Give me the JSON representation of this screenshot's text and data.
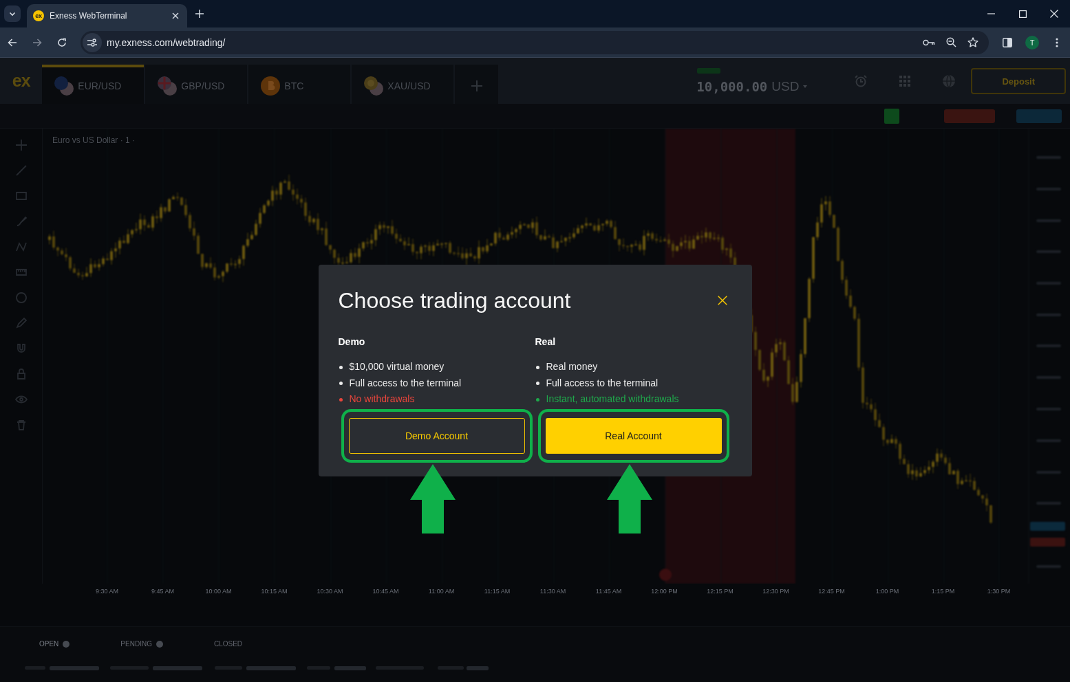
{
  "browser": {
    "tab": {
      "favicon": "ex",
      "title": "Exness WebTerminal"
    },
    "address_bar": {
      "url": "my.exness.com/webtrading/"
    },
    "profile_initial": "T"
  },
  "terminal": {
    "logo": "ex",
    "instrument_tabs": [
      {
        "label": "EUR/USD",
        "kind": "euro",
        "selected": true
      },
      {
        "label": "GBP/USD",
        "kind": "pound",
        "selected": false
      },
      {
        "label": "BTC",
        "kind": "bitcoin",
        "selected": false
      },
      {
        "label": "XAU/USD",
        "kind": "gold",
        "selected": false
      }
    ],
    "balance": {
      "amount": "10,000.00",
      "currency": "USD"
    },
    "deposit_button": "Deposit",
    "chart": {
      "title": "Euro vs US Dollar · 1 ·",
      "time_labels": [
        "9:30 AM",
        "9:45 AM",
        "10:00 AM",
        "10:15 AM",
        "10:30 AM",
        "10:45 AM",
        "11:00 AM",
        "11:15 AM",
        "11:30 AM",
        "11:45 AM",
        "12:00 PM",
        "12:15 PM",
        "12:30 PM",
        "12:45 PM",
        "1:00 PM",
        "1:15 PM",
        "1:30 PM"
      ]
    },
    "bottom_tabs": [
      {
        "label": "OPEN",
        "selected": true,
        "count_badge": true
      },
      {
        "label": "PENDING",
        "selected": false,
        "count_badge": true
      },
      {
        "label": "CLOSED",
        "selected": false,
        "count_badge": false
      }
    ]
  },
  "dialog": {
    "title": "Choose trading account",
    "options": [
      {
        "heading": "Demo",
        "features": [
          {
            "text": "$10,000 virtual money",
            "kind": "plain"
          },
          {
            "text": "Full access to the terminal",
            "kind": "plain"
          },
          {
            "text": "No withdrawals",
            "kind": "negative"
          }
        ],
        "button": {
          "label": "Demo Account",
          "kind": "outline",
          "highlighted": true
        }
      },
      {
        "heading": "Real",
        "features": [
          {
            "text": "Real money",
            "kind": "plain"
          },
          {
            "text": "Full access to the terminal",
            "kind": "plain"
          },
          {
            "text": "Instant, automated withdrawals",
            "kind": "positive"
          }
        ],
        "button": {
          "label": "Real Account",
          "kind": "filled",
          "highlighted": true
        }
      }
    ]
  }
}
